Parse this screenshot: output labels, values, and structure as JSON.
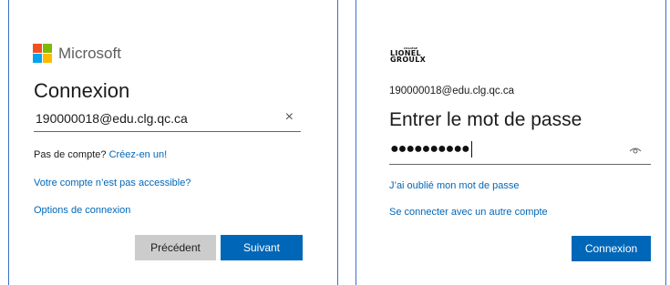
{
  "left": {
    "brand": "Microsoft",
    "title": "Connexion",
    "email_value": "190000018@edu.clg.qc.ca",
    "no_account_text": "Pas de compte?",
    "create_link": "Créez-en un!",
    "not_accessible_link": "Votre compte n’est pas accessible?",
    "sign_in_options_link": "Options de connexion",
    "back_button": "Précédent",
    "next_button": "Suivant",
    "logo_colors": [
      "#f25022",
      "#7fba00",
      "#00a4ef",
      "#ffb900"
    ]
  },
  "right": {
    "school_logo": {
      "tiny": "COLLÈGE",
      "line1": "LIONEL",
      "line2": "GROULX"
    },
    "user_email": "190000018@edu.clg.qc.ca",
    "title": "Entrer le mot de passe",
    "password_value": "●●●●●●●●●●",
    "forgot_link": "J’ai oublié mon mot de passe",
    "other_account_link": "Se connecter avec un autre compte",
    "signin_button": "Connexion"
  },
  "colors": {
    "accent": "#0067b8",
    "border": "#3a6fc4",
    "secondary_button": "#cccccc"
  },
  "icons": {
    "clear": "close-icon",
    "reveal": "eye-icon"
  }
}
